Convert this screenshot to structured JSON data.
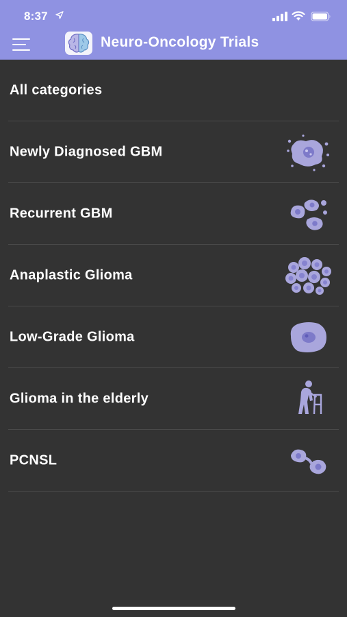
{
  "status_bar": {
    "time": "8:37",
    "icons": [
      "location-arrow-icon",
      "cellular-signal-icon",
      "wifi-icon",
      "battery-icon"
    ]
  },
  "nav": {
    "title": "Neuro-Oncology Trials",
    "menu_icon": "hamburger-menu-icon",
    "logo_icon": "brain-logo-icon"
  },
  "colors": {
    "header": "#8f92e2",
    "background": "#333333",
    "divider": "#4a4a4a",
    "icon_fill": "#a9a6dc"
  },
  "categories": [
    {
      "label": "All categories",
      "icon": ""
    },
    {
      "label": "Newly Diagnosed GBM",
      "icon": "tumor-cell-icon"
    },
    {
      "label": "Recurrent GBM",
      "icon": "dividing-cells-icon"
    },
    {
      "label": "Anaplastic Glioma",
      "icon": "cell-cluster-icon"
    },
    {
      "label": "Low-Grade Glioma",
      "icon": "single-cell-icon"
    },
    {
      "label": "Glioma in the elderly",
      "icon": "elderly-person-walker-icon"
    },
    {
      "label": "PCNSL",
      "icon": "linked-cells-icon"
    }
  ]
}
